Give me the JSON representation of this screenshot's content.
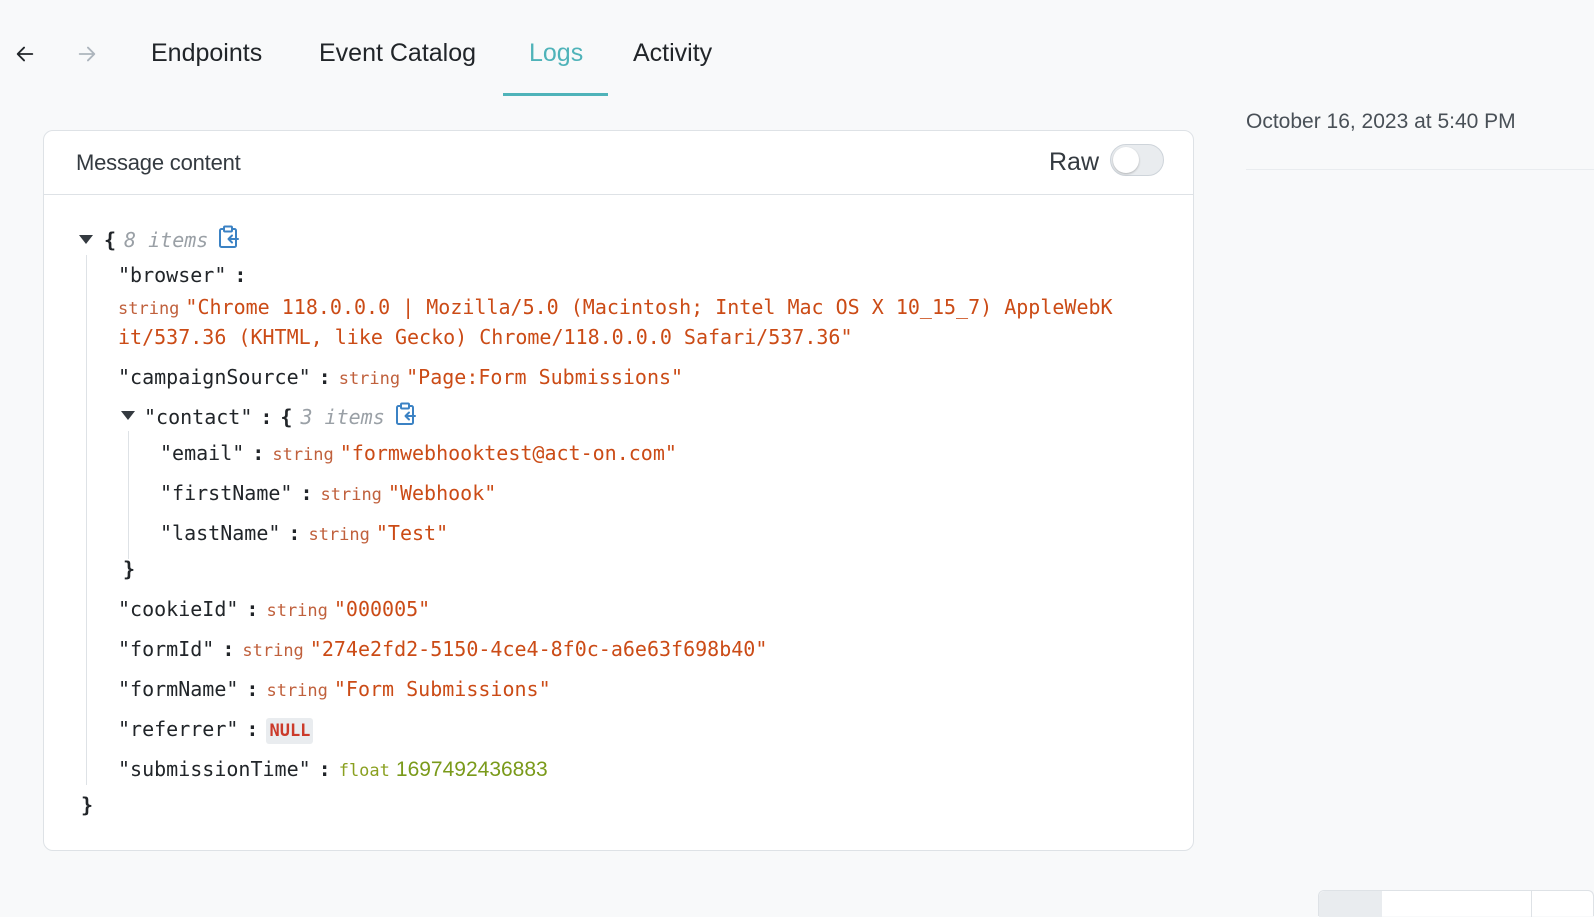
{
  "nav": {
    "back_icon": "arrow-left-icon",
    "forward_icon": "arrow-right-icon",
    "tabs": [
      {
        "label": "Endpoints",
        "active": false
      },
      {
        "label": "Event Catalog",
        "active": false
      },
      {
        "label": "Logs",
        "active": true
      },
      {
        "label": "Activity",
        "active": false
      }
    ]
  },
  "sidebar": {
    "timestamp": "October 16, 2023 at 5:40 PM"
  },
  "message": {
    "title": "Message content",
    "raw_label": "Raw",
    "raw_enabled": false,
    "root": {
      "open": "{",
      "close": "}",
      "count": "8 items",
      "copy_icon": "clipboard-copy-icon"
    },
    "fields": {
      "browser": {
        "key": "\"browser\"",
        "type": "string",
        "value_line1": "\"Chrome 118.0.0.0 | Mozilla/5.0 (Macintosh; Intel Mac OS X 10_15_7) AppleWebK",
        "value_line2": "it/537.36 (KHTML, like Gecko) Chrome/118.0.0.0 Safari/537.36\""
      },
      "campaignSource": {
        "key": "\"campaignSource\"",
        "type": "string",
        "value": "\"Page:Form Submissions\""
      },
      "contact": {
        "key": "\"contact\"",
        "open": "{",
        "close": "}",
        "count": "3 items",
        "email": {
          "key": "\"email\"",
          "type": "string",
          "value": "\"formwebhooktest@act-on.com\""
        },
        "firstName": {
          "key": "\"firstName\"",
          "type": "string",
          "value": "\"Webhook\""
        },
        "lastName": {
          "key": "\"lastName\"",
          "type": "string",
          "value": "\"Test\""
        }
      },
      "cookieId": {
        "key": "\"cookieId\"",
        "type": "string",
        "value": "\"000005\""
      },
      "formId": {
        "key": "\"formId\"",
        "type": "string",
        "value": "\"274e2fd2-5150-4ce4-8f0c-a6e63f698b40\""
      },
      "formName": {
        "key": "\"formName\"",
        "type": "string",
        "value": "\"Form Submissions\""
      },
      "referrer": {
        "key": "\"referrer\"",
        "value": "NULL"
      },
      "submissionTime": {
        "key": "\"submissionTime\"",
        "type": "float",
        "value": "1697492436883"
      }
    }
  },
  "colors": {
    "accent": "#4fb3b9",
    "string_value": "#cb4b16",
    "float_value": "#7a9a1a",
    "null_value": "#cb3a2a"
  }
}
